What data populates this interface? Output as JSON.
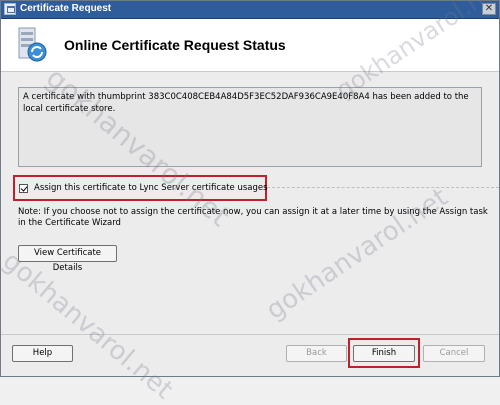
{
  "window": {
    "title": "Certificate Request",
    "close_glyph": "✕"
  },
  "header": {
    "title": "Online Certificate Request Status",
    "icon": "certificate-wizard-icon"
  },
  "status_message": "A certificate with thumbprint 383C0C408CEB4A84D5F3EC52DAF936CA9E40F8A4 has been added to the local certificate store.",
  "assign_option": {
    "label": "Assign this certificate to Lync Server certificate usages",
    "checked": true
  },
  "note": "Note: If you choose not to assign the certificate now, you can assign it at a later time by using the Assign task in the Certificate Wizard",
  "buttons": {
    "view_details": "View Certificate Details",
    "help": "Help",
    "back": "Back",
    "finish": "Finish",
    "cancel": "Cancel"
  },
  "watermark": "gokhanvarol.net",
  "highlight_color": "#c0202a"
}
